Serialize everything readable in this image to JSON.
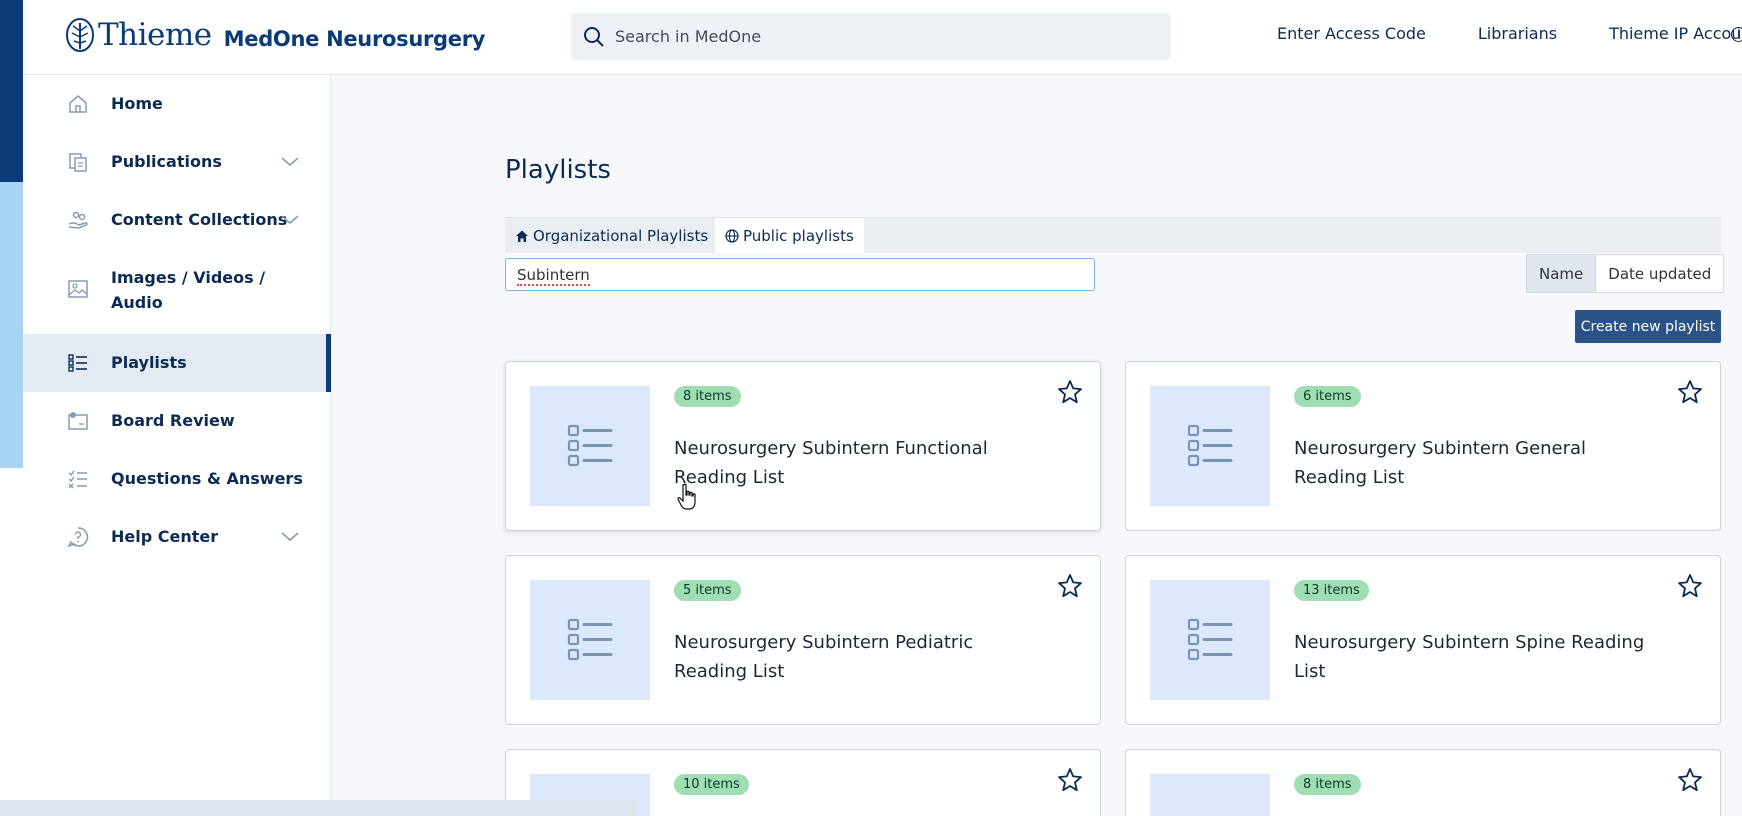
{
  "header": {
    "logo_word": "Thieme",
    "product": "MedOne Neurosurgery",
    "search_placeholder": "Search in MedOne",
    "links": [
      "Enter Access Code",
      "Librarians",
      "Thieme IP Account"
    ]
  },
  "sidebar": {
    "items": [
      {
        "label": "Home",
        "icon": "home-icon",
        "expandable": false,
        "active": false
      },
      {
        "label": "Publications",
        "icon": "publications-icon",
        "expandable": true,
        "active": false
      },
      {
        "label": "Content Collections",
        "icon": "collections-icon",
        "expandable": true,
        "active": false
      },
      {
        "label": "Images / Videos / Audio",
        "icon": "image-icon",
        "expandable": false,
        "active": false
      },
      {
        "label": "Playlists",
        "icon": "playlist-icon",
        "expandable": false,
        "active": true
      },
      {
        "label": "Board Review",
        "icon": "board-review-icon",
        "expandable": false,
        "active": false
      },
      {
        "label": "Questions & Answers",
        "icon": "qa-icon",
        "expandable": false,
        "active": false
      },
      {
        "label": "Help Center",
        "icon": "help-icon",
        "expandable": true,
        "active": false
      }
    ]
  },
  "main": {
    "title": "Playlists",
    "tabs": [
      {
        "label": "Organizational Playlists",
        "icon": "home-icon",
        "active": false
      },
      {
        "label": "Public playlists",
        "icon": "globe-icon",
        "active": true
      }
    ],
    "filter_value": "Subintern",
    "sort": {
      "options": [
        "Name",
        "Date updated"
      ],
      "selected": "Name"
    },
    "create_label": "Create new playlist",
    "cards": [
      {
        "items": "8 items",
        "title": "Neurosurgery Subintern Functional Reading List"
      },
      {
        "items": "6 items",
        "title": "Neurosurgery Subintern General Reading List"
      },
      {
        "items": "5 items",
        "title": "Neurosurgery Subintern Pediatric Reading List"
      },
      {
        "items": "13 items",
        "title": "Neurosurgery Subintern Spine Reading List"
      },
      {
        "items": "10 items",
        "title": ""
      },
      {
        "items": "8 items",
        "title": ""
      }
    ]
  },
  "colors": {
    "brand": "#0b3a78",
    "accent_light": "#a5d5f1",
    "badge_bg": "#9fddb2",
    "create_button": "#2a5286",
    "thumb_bg": "#dce8fb"
  }
}
